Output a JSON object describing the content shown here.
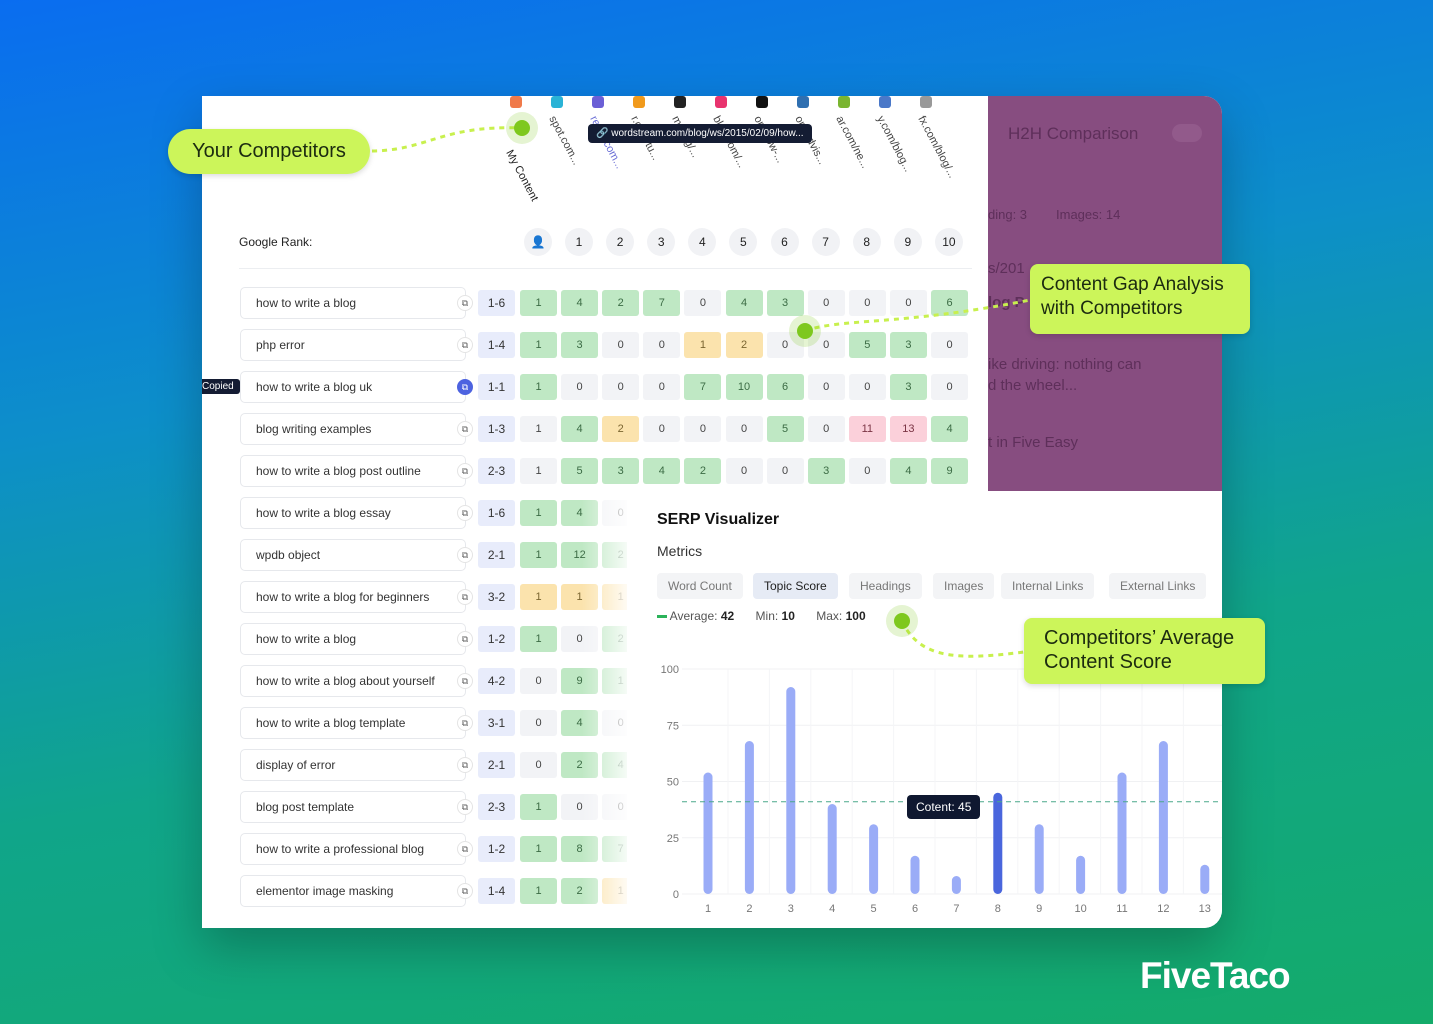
{
  "brand": "FiveTaco",
  "callouts": {
    "competitors": "Your Competitors",
    "gap": "Content Gap Analysis with Competitors",
    "avg": "Competitors’ Average Content Score"
  },
  "competitors": [
    {
      "label": "My Content",
      "color": "#f07a4a"
    },
    {
      "label": "spot.com...",
      "color": "#2ab3d6"
    },
    {
      "label": "ream.com...",
      "color": "#6b5fd6"
    },
    {
      "label": "r.com/tu...",
      "color": "#f19a1c"
    },
    {
      "label": "m/blog/...",
      "color": "#222222"
    },
    {
      "label": "blog.com/...",
      "color": "#e8336e"
    },
    {
      "label": "om/how-...",
      "color": "#111111"
    },
    {
      "label": "om/advis...",
      "color": "#2f6fb0"
    },
    {
      "label": "ar.com/ne...",
      "color": "#7ab530"
    },
    {
      "label": "y.com/blog...",
      "color": "#4a78c8"
    },
    {
      "label": "fx.com/blog/...",
      "color": "#999999"
    }
  ],
  "tooltip_url": "wordstream.com/blog/ws/2015/02/09/how...",
  "google_rank_label": "Google Rank:",
  "rank_headers": [
    "1",
    "2",
    "3",
    "4",
    "5",
    "6",
    "7",
    "8",
    "9",
    "10"
  ],
  "copied_label": "Copied",
  "rows": [
    {
      "kw": "how to write a blog",
      "rank": "1-6",
      "cells": [
        [
          "1",
          "g"
        ],
        [
          "4",
          "g"
        ],
        [
          "2",
          "g"
        ],
        [
          "7",
          "g"
        ],
        [
          "0",
          "n"
        ],
        [
          "4",
          "g"
        ],
        [
          "3",
          "g"
        ],
        [
          "0",
          "n"
        ],
        [
          "0",
          "n"
        ],
        [
          "0",
          "n"
        ],
        [
          "6",
          "g"
        ]
      ]
    },
    {
      "kw": "php error",
      "rank": "1-4",
      "cells": [
        [
          "1",
          "g"
        ],
        [
          "3",
          "g"
        ],
        [
          "0",
          "n"
        ],
        [
          "0",
          "n"
        ],
        [
          "1",
          "y"
        ],
        [
          "2",
          "y"
        ],
        [
          "0",
          "n"
        ],
        [
          "0",
          "n"
        ],
        [
          "5",
          "g"
        ],
        [
          "3",
          "g"
        ],
        [
          "0",
          "n"
        ]
      ]
    },
    {
      "kw": "how to write a blog uk",
      "rank": "1-1",
      "copied": true,
      "cells": [
        [
          "1",
          "g"
        ],
        [
          "0",
          "n"
        ],
        [
          "0",
          "n"
        ],
        [
          "0",
          "n"
        ],
        [
          "7",
          "g"
        ],
        [
          "10",
          "g"
        ],
        [
          "6",
          "g"
        ],
        [
          "0",
          "n"
        ],
        [
          "0",
          "n"
        ],
        [
          "3",
          "g"
        ],
        [
          "0",
          "n"
        ]
      ]
    },
    {
      "kw": "blog writing examples",
      "rank": "1-3",
      "cells": [
        [
          "1",
          "n"
        ],
        [
          "4",
          "g"
        ],
        [
          "2",
          "y"
        ],
        [
          "0",
          "n"
        ],
        [
          "0",
          "n"
        ],
        [
          "0",
          "n"
        ],
        [
          "5",
          "g"
        ],
        [
          "0",
          "n"
        ],
        [
          "11",
          "r"
        ],
        [
          "13",
          "r"
        ],
        [
          "4",
          "g"
        ]
      ]
    },
    {
      "kw": "how to write a blog post outline",
      "rank": "2-3",
      "cells": [
        [
          "1",
          "n"
        ],
        [
          "5",
          "g"
        ],
        [
          "3",
          "g"
        ],
        [
          "4",
          "g"
        ],
        [
          "2",
          "g"
        ],
        [
          "0",
          "n"
        ],
        [
          "0",
          "n"
        ],
        [
          "3",
          "g"
        ],
        [
          "0",
          "n"
        ],
        [
          "4",
          "g"
        ],
        [
          "9",
          "g"
        ]
      ]
    },
    {
      "kw": "how to write a blog essay",
      "rank": "1-6",
      "cells": [
        [
          "1",
          "g"
        ],
        [
          "4",
          "g"
        ],
        [
          "0",
          "n"
        ]
      ]
    },
    {
      "kw": "wpdb object",
      "rank": "2-1",
      "cells": [
        [
          "1",
          "g"
        ],
        [
          "12",
          "g"
        ],
        [
          "2",
          "g"
        ]
      ]
    },
    {
      "kw": "how to write a blog for beginners",
      "rank": "3-2",
      "cells": [
        [
          "1",
          "y"
        ],
        [
          "1",
          "y"
        ],
        [
          "1",
          "y"
        ]
      ]
    },
    {
      "kw": "how to write a blog",
      "rank": "1-2",
      "cells": [
        [
          "1",
          "g"
        ],
        [
          "0",
          "n"
        ],
        [
          "2",
          "g"
        ]
      ]
    },
    {
      "kw": "how to write a blog about yourself",
      "rank": "4-2",
      "cells": [
        [
          "0",
          "n"
        ],
        [
          "9",
          "g"
        ],
        [
          "1",
          "g"
        ]
      ]
    },
    {
      "kw": "how to write a blog template",
      "rank": "3-1",
      "cells": [
        [
          "0",
          "n"
        ],
        [
          "4",
          "g"
        ],
        [
          "0",
          "n"
        ]
      ]
    },
    {
      "kw": "display of error",
      "rank": "2-1",
      "cells": [
        [
          "0",
          "n"
        ],
        [
          "2",
          "g"
        ],
        [
          "4",
          "g"
        ]
      ]
    },
    {
      "kw": "blog post template",
      "rank": "2-3",
      "cells": [
        [
          "1",
          "g"
        ],
        [
          "0",
          "n"
        ],
        [
          "0",
          "n"
        ]
      ]
    },
    {
      "kw": "how to write a professional blog",
      "rank": "1-2",
      "cells": [
        [
          "1",
          "g"
        ],
        [
          "8",
          "g"
        ],
        [
          "7",
          "g"
        ]
      ]
    },
    {
      "kw": "elementor image masking",
      "rank": "1-4",
      "cells": [
        [
          "1",
          "g"
        ],
        [
          "2",
          "g"
        ],
        [
          "1",
          "y"
        ]
      ]
    }
  ],
  "h2h": {
    "title": "H2H Comparison",
    "stats": [
      "ding: 3",
      "Images: 14"
    ],
    "snippets": [
      "s/201",
      "log P",
      "ike driving: nothing can",
      "d the wheel...",
      "t in Five Easy"
    ]
  },
  "serp": {
    "title": "SERP Visualizer",
    "metrics_label": "Metrics",
    "tabs": [
      "Word Count",
      "Topic Score",
      "Headings",
      "Images",
      "Internal Links",
      "External Links"
    ],
    "active_tab": "Topic Score",
    "average_label": "Average:",
    "average": "42",
    "min_label": "Min:",
    "min": "10",
    "max_label": "Max:",
    "max": "100",
    "tooltip": "Cotent: 45"
  },
  "chart_data": {
    "type": "bar",
    "categories": [
      "1",
      "2",
      "3",
      "4",
      "5",
      "6",
      "7",
      "8",
      "9",
      "10",
      "11",
      "12",
      "13"
    ],
    "values": [
      54,
      68,
      92,
      40,
      31,
      17,
      8,
      45,
      31,
      17,
      54,
      68,
      13
    ],
    "highlight_index": 7,
    "average_line": 42,
    "yticks": [
      "0",
      "25",
      "50",
      "75",
      "100"
    ],
    "ylim": [
      0,
      100
    ],
    "grid": true,
    "bar_color": "#9aacf7",
    "highlight_color": "#4a66dd"
  }
}
